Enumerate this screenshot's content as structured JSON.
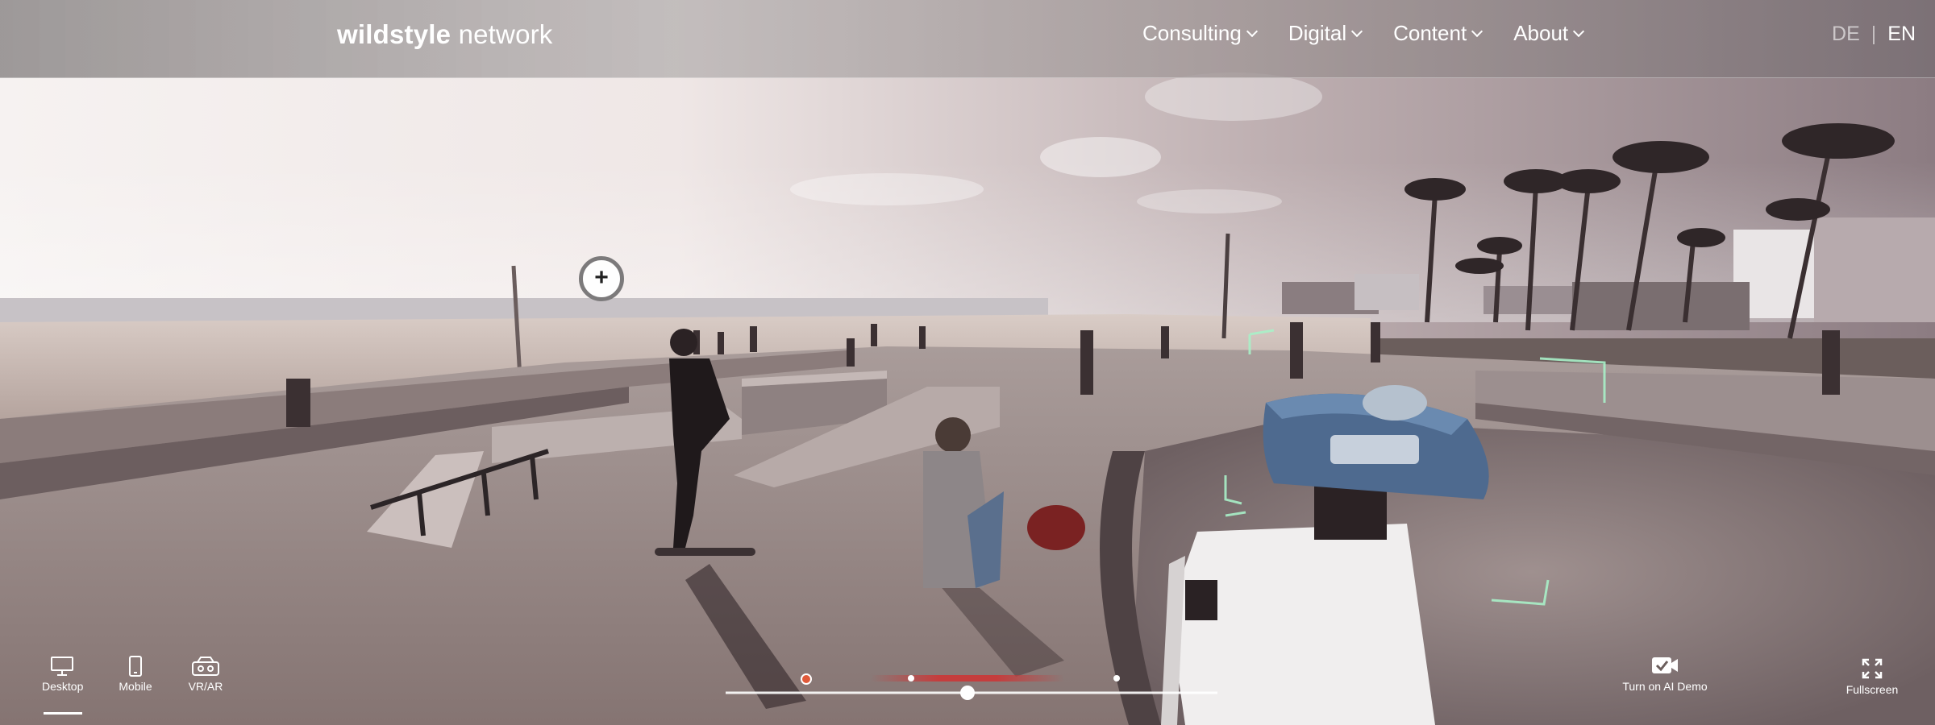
{
  "header": {
    "logo_bold": "wildstyle",
    "logo_light": "network",
    "nav": [
      {
        "label": "Consulting"
      },
      {
        "label": "Digital"
      },
      {
        "label": "Content"
      },
      {
        "label": "About"
      }
    ],
    "lang": {
      "de": "DE",
      "separator": "|",
      "en": "EN"
    }
  },
  "hotspot": {
    "symbol": "+"
  },
  "controls": {
    "desktop": "Desktop",
    "mobile": "Mobile",
    "vr": "VR/AR",
    "ai_demo": "Turn on AI Demo",
    "fullscreen": "Fullscreen"
  },
  "timeline": {
    "progress": 0.4
  },
  "colors": {
    "accent": "#e05a3a",
    "heat": "#c83a3a",
    "ai_frame": "#a9f0c8"
  }
}
